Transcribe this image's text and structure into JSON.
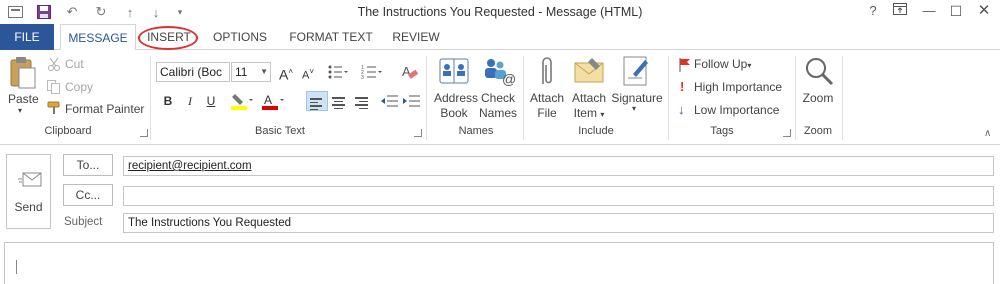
{
  "window": {
    "title": "The Instructions You Requested - Message (HTML)",
    "help": "?",
    "restore": "⧉",
    "minimize": "—",
    "maximize": "☐"
  },
  "tabs": [
    "FILE",
    "MESSAGE",
    "INSERT",
    "OPTIONS",
    "FORMAT TEXT",
    "REVIEW"
  ],
  "clipboard": {
    "paste": "Paste",
    "cut": "Cut",
    "copy": "Copy",
    "format_painter": "Format Painter",
    "label": "Clipboard"
  },
  "basic_text": {
    "font": "Calibri (Boc",
    "size": "11",
    "label": "Basic Text",
    "bold": "B",
    "italic": "I",
    "underline": "U"
  },
  "names": {
    "address_book_1": "Address",
    "address_book_2": "Book",
    "check_names_1": "Check",
    "check_names_2": "Names",
    "label": "Names"
  },
  "include": {
    "attach_file_1": "Attach",
    "attach_file_2": "File",
    "attach_item_1": "Attach",
    "attach_item_2": "Item",
    "signature": "Signature",
    "label": "Include"
  },
  "tags": {
    "follow_up": "Follow Up",
    "high": "High Importance",
    "low": "Low Importance",
    "label": "Tags"
  },
  "zoom": {
    "zoom_btn": "Zoom",
    "label": "Zoom"
  },
  "compose": {
    "send": "Send",
    "to_btn": "To...",
    "cc_btn": "Cc...",
    "subject_label": "Subject",
    "to_value": "recipient@recipient.com",
    "cc_value": "",
    "subject_value": "The Instructions You Requested"
  },
  "colors": {
    "file_tab": "#2b579a",
    "annotation": "#d9342b",
    "highlight": "#ffff00",
    "font_color": "#e00000"
  }
}
